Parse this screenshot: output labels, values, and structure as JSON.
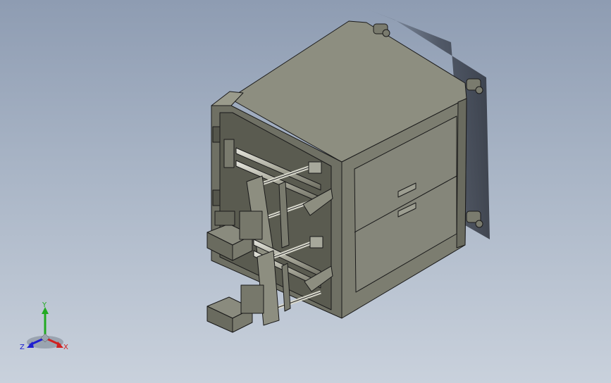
{
  "viewport": {
    "background_top": "#8e9cb2",
    "background_bottom": "#c9d1dc",
    "model_body_color": "#8a8b7c",
    "model_edge_color": "#1a1a1a"
  },
  "triad": {
    "y_label": "Y",
    "z_label": "Z",
    "x_label": "X",
    "y_color": "#22aa22",
    "x_color": "#d02020",
    "z_color": "#2020d0"
  }
}
